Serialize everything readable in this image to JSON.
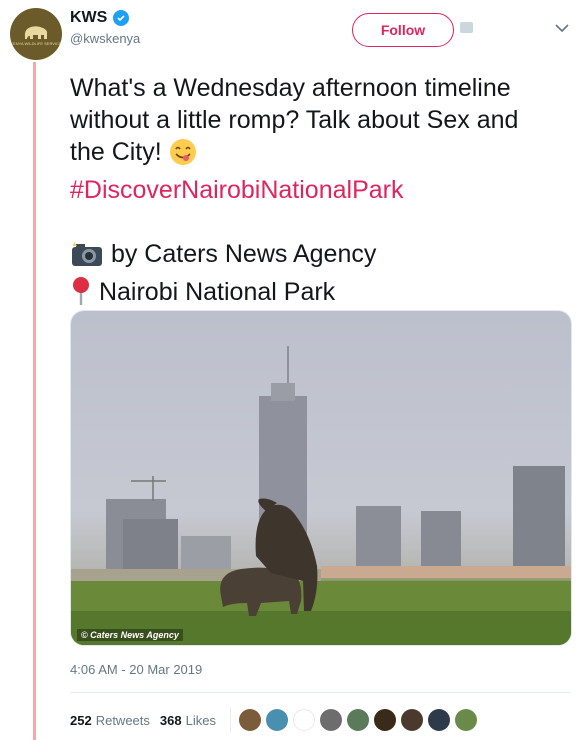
{
  "account": {
    "display_name": "KWS",
    "handle": "@kwskenya",
    "avatar_text": "KENYA WILDLIFE SERVICE",
    "verified": true
  },
  "actions": {
    "follow_label": "Follow"
  },
  "tweet": {
    "line1": "What's a Wednesday afternoon timeline",
    "line2": "without a little romp? Talk about Sex and",
    "line3": "the City!",
    "hashtag": "#DiscoverNairobiNationalPark",
    "credit_line": "by Caters News Agency",
    "location_line": "Nairobi National Park"
  },
  "media": {
    "watermark": "© Caters News Agency"
  },
  "meta": {
    "timestamp": "4:06 AM - 20 Mar 2019"
  },
  "stats": {
    "retweets_count": "252",
    "retweets_label": "Retweets",
    "likes_count": "368",
    "likes_label": "Likes"
  },
  "colors": {
    "accent": "#e0245e",
    "thread_line": "#f4a7ad",
    "secondary_text": "#657786",
    "verified": "#1da1f2"
  },
  "likers": [
    {
      "icon": "avatar",
      "color": "#7a5c3a"
    },
    {
      "icon": "avatar",
      "color": "#4a8fb0"
    },
    {
      "icon": "avatar",
      "color": "#ffffff"
    },
    {
      "icon": "avatar",
      "color": "#6d6d6d"
    },
    {
      "icon": "avatar",
      "color": "#5a7a5a"
    },
    {
      "icon": "avatar",
      "color": "#3a2a1a"
    },
    {
      "icon": "avatar",
      "color": "#4a3a2e"
    },
    {
      "icon": "avatar",
      "color": "#2e3a4a"
    },
    {
      "icon": "avatar",
      "color": "#6a8a4a"
    }
  ]
}
